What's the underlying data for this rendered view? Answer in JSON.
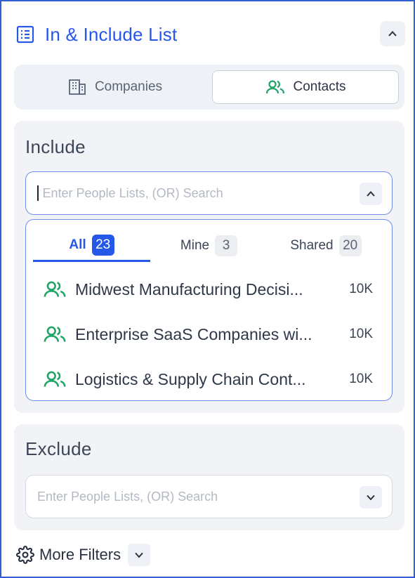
{
  "header": {
    "title": "In & Include List",
    "icon": "list-icon"
  },
  "toggle": {
    "companies_label": "Companies",
    "contacts_label": "Contacts",
    "selected": "Contacts"
  },
  "include": {
    "title": "Include",
    "placeholder": "Enter People Lists, (OR) Search",
    "tabs": [
      {
        "label": "All",
        "count": "23"
      },
      {
        "label": "Mine",
        "count": "3"
      },
      {
        "label": "Shared",
        "count": "20"
      }
    ],
    "items": [
      {
        "name": "Midwest Manufacturing Decisi...",
        "size": "10K"
      },
      {
        "name": "Enterprise SaaS Companies wi...",
        "size": "10K"
      },
      {
        "name": "Logistics & Supply Chain Cont...",
        "size": "10K"
      }
    ]
  },
  "exclude": {
    "title": "Exclude",
    "placeholder": "Enter People Lists, (OR) Search"
  },
  "footer": {
    "more_filters_label": "More Filters"
  },
  "colors": {
    "accent": "#2557e8",
    "contact_icon": "#20a566",
    "panel_bg": "#f1f3f6"
  }
}
